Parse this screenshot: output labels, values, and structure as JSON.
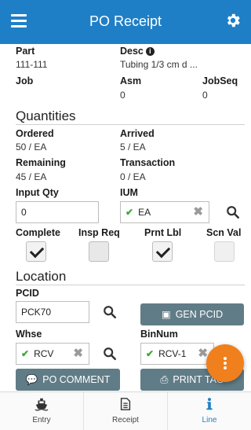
{
  "header": {
    "title": "PO Receipt",
    "menu_icon": "menu-icon",
    "settings_icon": "gear-icon",
    "color": "#1f7fc6"
  },
  "details": {
    "part_label": "Part",
    "part_value": "111-111",
    "desc_label": "Desc",
    "desc_value": "Tubing 1/3 cm d ...",
    "job_label": "Job",
    "asm_label": "Asm",
    "asm_value": "0",
    "jobseq_label": "JobSeq",
    "jobseq_value": "0"
  },
  "quantities": {
    "title": "Quantities",
    "ordered_label": "Ordered",
    "ordered_value": "50 / EA",
    "arrived_label": "Arrived",
    "arrived_value": "5 / EA",
    "remaining_label": "Remaining",
    "remaining_value": "45 / EA",
    "transaction_label": "Transaction",
    "transaction_value": "0 / EA",
    "input_qty_label": "Input Qty",
    "input_qty_value": "0",
    "ium_label": "IUM",
    "ium_value": "EA"
  },
  "flags": {
    "complete_label": "Complete",
    "complete_checked": true,
    "insp_req_label": "Insp Req",
    "insp_req_checked": false,
    "prnt_lbl_label": "Prnt Lbl",
    "prnt_lbl_checked": true,
    "scn_val_label": "Scn Val",
    "scn_val_checked": false
  },
  "location": {
    "title": "Location",
    "pcid_label": "PCID",
    "pcid_value": "PCK70",
    "gen_pcid_label": "GEN PCID",
    "whse_label": "Whse",
    "whse_value": "RCV",
    "binnum_label": "BinNum",
    "binnum_value": "RCV-1",
    "po_comment_label": "PO COMMENT",
    "print_tag_label": "PRINT TAG"
  },
  "tabs": [
    {
      "label": "Entry",
      "icon": "ship-icon"
    },
    {
      "label": "Receipt",
      "icon": "document-icon"
    },
    {
      "label": "Line",
      "icon": "info-icon",
      "active": true
    }
  ],
  "accent_colors": {
    "button": "#607c87",
    "fab": "#f07f1d",
    "check": "#3aa835"
  }
}
